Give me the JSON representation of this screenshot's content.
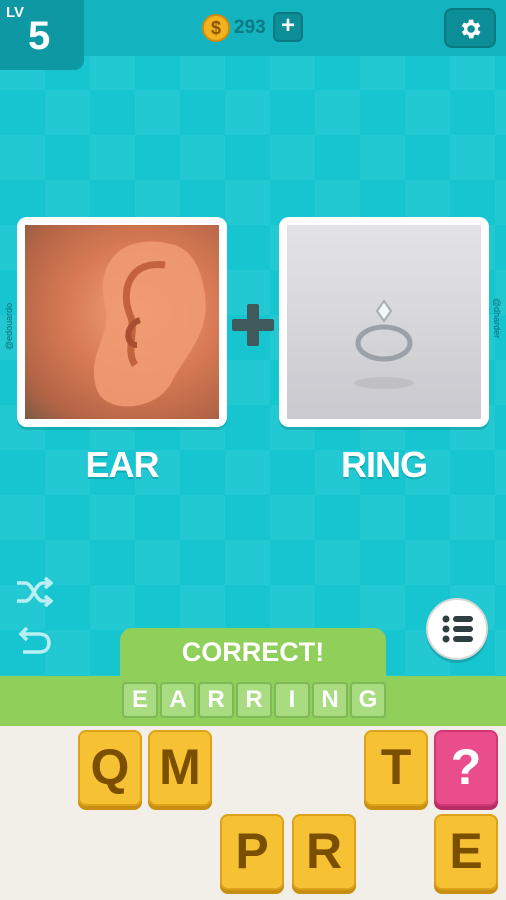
{
  "header": {
    "level_label": "LV",
    "level_number": "5",
    "coin_symbol": "$",
    "coins": "293",
    "add_coins_label": "+"
  },
  "puzzle": {
    "left_credit": "@edouardo",
    "right_credit": "@dharder",
    "left_word": "EAR",
    "right_word": "RING"
  },
  "result": {
    "status": "CORRECT!",
    "answer_letters": [
      "E",
      "A",
      "R",
      "R",
      "I",
      "N",
      "G"
    ]
  },
  "keyboard": {
    "row1": [
      "Q",
      "M",
      "T",
      "?"
    ],
    "row2": [
      "P",
      "R",
      "E"
    ]
  },
  "colors": {
    "background": "#16c5d0",
    "success_green": "#8fcf5a",
    "key_yellow": "#f6c234",
    "hint_pink": "#ea4d8c"
  }
}
